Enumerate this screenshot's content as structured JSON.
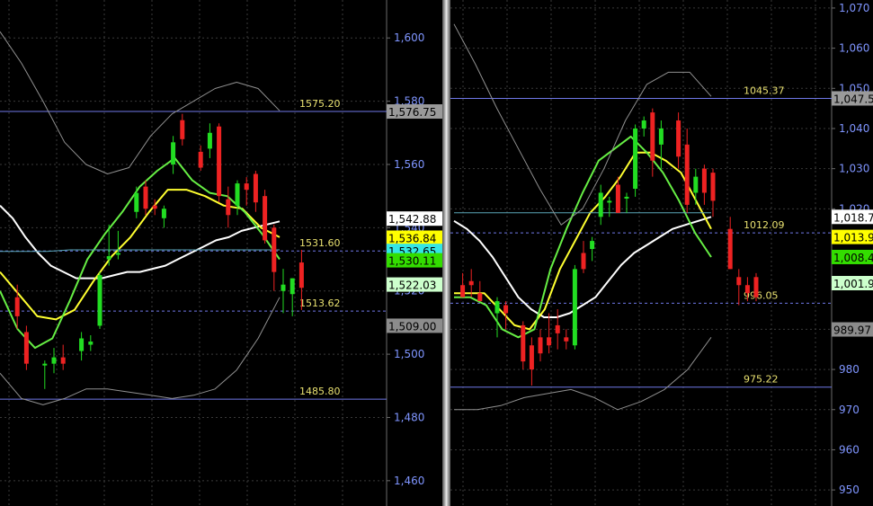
{
  "chart_data": [
    {
      "type": "candlestick",
      "y_axis_ticks": [
        "1,600",
        "1,580",
        "1,560",
        "1,540",
        "1,520",
        "1,500",
        "1,480",
        "1,460"
      ],
      "y_axis_tick_values": [
        1600,
        1580,
        1560,
        1540,
        1520,
        1500,
        1480,
        1460
      ],
      "ylim": [
        1452,
        1612
      ],
      "grid": true,
      "x_count": 40,
      "reference_lines": [
        {
          "label": "1575.20",
          "value": 1576.75,
          "color": "#6f78e8",
          "dashed": false
        },
        {
          "label": "1531.60",
          "value": 1532.65,
          "color": "#6f78e8",
          "dashed": true
        },
        {
          "label": "1513.62",
          "value": 1513.62,
          "color": "#6f78e8",
          "dashed": true
        },
        {
          "label": "1485.80",
          "value": 1485.8,
          "color": "#6f78e8",
          "dashed": false
        }
      ],
      "price_tags": [
        {
          "label": "1,576.75",
          "value": 1576.75,
          "bg": "#9a9a9a",
          "fg": "#000000"
        },
        {
          "label": "1,542.88",
          "value": 1542.88,
          "bg": "#ffffff",
          "fg": "#000000"
        },
        {
          "label": "1,536.84",
          "value": 1536.84,
          "bg": "#ffff00",
          "fg": "#000000"
        },
        {
          "label": "1,532.65",
          "value": 1532.65,
          "bg": "#33e6e6",
          "fg": "#000000"
        },
        {
          "label": "1,530.11",
          "value": 1529.7,
          "bg": "#33dd00",
          "fg": "#000000"
        },
        {
          "label": "1,522.03",
          "value": 1522.03,
          "bg": "#ccffcc",
          "fg": "#000000"
        },
        {
          "label": "1,509.00",
          "value": 1509.0,
          "bg": "#8c8c8c",
          "fg": "#000000"
        }
      ],
      "candles": [
        {
          "x": 1,
          "o": 1518,
          "h": 1522,
          "l": 1508,
          "c": 1512
        },
        {
          "x": 2,
          "o": 1507,
          "h": 1509,
          "l": 1495,
          "c": 1497
        },
        {
          "x": 4,
          "o": 1497,
          "h": 1498,
          "l": 1489,
          "c": 1497
        },
        {
          "x": 5,
          "o": 1497,
          "h": 1502,
          "l": 1494,
          "c": 1499
        },
        {
          "x": 6,
          "o": 1499,
          "h": 1503,
          "l": 1495,
          "c": 1497
        },
        {
          "x": 8,
          "o": 1501,
          "h": 1507,
          "l": 1498,
          "c": 1505
        },
        {
          "x": 9,
          "o": 1503,
          "h": 1506,
          "l": 1501,
          "c": 1504
        },
        {
          "x": 10,
          "o": 1509,
          "h": 1526,
          "l": 1508,
          "c": 1525
        },
        {
          "x": 11,
          "o": 1530,
          "h": 1541,
          "l": 1528,
          "c": 1531
        },
        {
          "x": 12,
          "o": 1532,
          "h": 1539,
          "l": 1530,
          "c": 1532
        },
        {
          "x": 14,
          "o": 1545,
          "h": 1553,
          "l": 1543,
          "c": 1551
        },
        {
          "x": 15,
          "o": 1553,
          "h": 1555,
          "l": 1544,
          "c": 1546
        },
        {
          "x": 16,
          "o": 1547,
          "h": 1549,
          "l": 1544,
          "c": 1546
        },
        {
          "x": 17,
          "o": 1543,
          "h": 1547,
          "l": 1540,
          "c": 1546
        },
        {
          "x": 18,
          "o": 1560,
          "h": 1569,
          "l": 1557,
          "c": 1567
        },
        {
          "x": 19,
          "o": 1574,
          "h": 1576,
          "l": 1566,
          "c": 1568
        },
        {
          "x": 21,
          "o": 1564,
          "h": 1566,
          "l": 1558,
          "c": 1559
        },
        {
          "x": 22,
          "o": 1565,
          "h": 1573,
          "l": 1562,
          "c": 1570
        },
        {
          "x": 23,
          "o": 1572,
          "h": 1573,
          "l": 1548,
          "c": 1550
        },
        {
          "x": 24,
          "o": 1549,
          "h": 1553,
          "l": 1540,
          "c": 1544
        },
        {
          "x": 25,
          "o": 1547,
          "h": 1555,
          "l": 1544,
          "c": 1554
        },
        {
          "x": 26,
          "o": 1554,
          "h": 1556,
          "l": 1547,
          "c": 1552
        },
        {
          "x": 27,
          "o": 1557,
          "h": 1558,
          "l": 1545,
          "c": 1548
        },
        {
          "x": 28,
          "o": 1550,
          "h": 1552,
          "l": 1535,
          "c": 1536
        },
        {
          "x": 29,
          "o": 1540,
          "h": 1541,
          "l": 1520,
          "c": 1526
        },
        {
          "x": 30,
          "o": 1520,
          "h": 1527,
          "l": 1513,
          "c": 1522
        },
        {
          "x": 31,
          "o": 1519,
          "h": 1524,
          "l": 1512,
          "c": 1524
        },
        {
          "x": 32,
          "o": 1529,
          "h": 1533,
          "l": 1514,
          "c": 1521
        }
      ],
      "lines": [
        {
          "name": "white",
          "color": "#ffffff",
          "width": 2,
          "values": [
            1547,
            1543,
            1537,
            1532,
            1528,
            1526,
            1524,
            1524,
            1524,
            1525,
            1526,
            1526,
            1527,
            1528,
            1530,
            1532,
            1534,
            1536,
            1537,
            1539,
            1540,
            1541,
            1542
          ]
        },
        {
          "name": "yellow",
          "color": "#ffff30",
          "width": 2,
          "values": [
            1526,
            1519,
            1512,
            1511,
            1514,
            1523,
            1531,
            1537,
            1545,
            1552,
            1552,
            1550,
            1547,
            1546,
            1540,
            1537
          ]
        },
        {
          "name": "green",
          "color": "#66ee44",
          "width": 2,
          "values": [
            1520,
            1508,
            1502,
            1505,
            1517,
            1530,
            1538,
            1545,
            1553,
            1558,
            1562,
            1555,
            1551,
            1550,
            1545,
            1538,
            1530
          ]
        },
        {
          "name": "cyan",
          "color": "#5aa6b8",
          "width": 1,
          "values": [
            1532.5,
            1532.5,
            1532.5,
            1533,
            1533,
            1533,
            1533,
            1533,
            1533,
            1533,
            1533,
            1533,
            1533
          ]
        },
        {
          "name": "upper-band",
          "color": "#909090",
          "width": 1,
          "values": [
            1602,
            1592,
            1580,
            1567,
            1560,
            1557,
            1559,
            1569,
            1576,
            1580,
            1584,
            1586,
            1584,
            1577
          ]
        },
        {
          "name": "lower-band",
          "color": "#909090",
          "width": 1,
          "values": [
            1494,
            1486,
            1484,
            1486,
            1489,
            1489,
            1488,
            1487,
            1486,
            1487,
            1489,
            1495,
            1505,
            1518
          ]
        }
      ]
    },
    {
      "type": "candlestick",
      "y_axis_ticks": [
        "1,070",
        "1,060",
        "1,050",
        "1,040",
        "1,030",
        "1,020",
        "990",
        "980",
        "970",
        "960",
        "950"
      ],
      "y_axis_tick_values": [
        1070,
        1060,
        1050,
        1040,
        1030,
        1020,
        990,
        980,
        970,
        960,
        950
      ],
      "ylim": [
        946,
        1072
      ],
      "grid": true,
      "x_count": 40,
      "reference_lines": [
        {
          "label": "1045.37",
          "value": 1047.5,
          "color": "#6f78e8",
          "dashed": false
        },
        {
          "label": "1012.09",
          "value": 1014.0,
          "color": "#6f78e8",
          "dashed": true
        },
        {
          "label": "996.05",
          "value": 996.5,
          "color": "#6f78e8",
          "dashed": true
        },
        {
          "label": "975.22",
          "value": 975.6,
          "color": "#6f78e8",
          "dashed": false
        }
      ],
      "price_tags": [
        {
          "label": "1,047.5",
          "value": 1047.5,
          "bg": "#9a9a9a",
          "fg": "#000000"
        },
        {
          "label": "1,018.7",
          "value": 1018.0,
          "bg": "#ffffff",
          "fg": "#000000"
        },
        {
          "label": "1,013.9",
          "value": 1013.0,
          "bg": "#ffff00",
          "fg": "#000000"
        },
        {
          "label": "1,008.4",
          "value": 1008.0,
          "bg": "#33dd00",
          "fg": "#000000"
        },
        {
          "label": "1,001.9",
          "value": 1001.5,
          "bg": "#ccffcc",
          "fg": "#000000"
        },
        {
          "label": "989.97",
          "value": 989.97,
          "bg": "#8c8c8c",
          "fg": "#000000"
        }
      ],
      "candles": [
        {
          "x": 1,
          "o": 1001,
          "h": 1004,
          "l": 998,
          "c": 998
        },
        {
          "x": 2,
          "o": 1002,
          "h": 1005,
          "l": 998,
          "c": 1001
        },
        {
          "x": 3,
          "o": 999,
          "h": 1002,
          "l": 997,
          "c": 997
        },
        {
          "x": 5,
          "o": 994,
          "h": 998,
          "l": 988,
          "c": 997
        },
        {
          "x": 6,
          "o": 996,
          "h": 997,
          "l": 990,
          "c": 994
        },
        {
          "x": 8,
          "o": 991,
          "h": 992,
          "l": 980,
          "c": 982
        },
        {
          "x": 9,
          "o": 986,
          "h": 988,
          "l": 976,
          "c": 980
        },
        {
          "x": 10,
          "o": 988,
          "h": 990,
          "l": 982,
          "c": 984
        },
        {
          "x": 11,
          "o": 988,
          "h": 994,
          "l": 984,
          "c": 986
        },
        {
          "x": 12,
          "o": 991,
          "h": 995,
          "l": 985,
          "c": 989
        },
        {
          "x": 13,
          "o": 988,
          "h": 990,
          "l": 985,
          "c": 987
        },
        {
          "x": 14,
          "o": 986,
          "h": 1006,
          "l": 985,
          "c": 1005
        },
        {
          "x": 15,
          "o": 1009,
          "h": 1012,
          "l": 1004,
          "c": 1005
        },
        {
          "x": 16,
          "o": 1010,
          "h": 1013,
          "l": 1007,
          "c": 1012
        },
        {
          "x": 17,
          "o": 1018,
          "h": 1026,
          "l": 1016,
          "c": 1024
        },
        {
          "x": 18,
          "o": 1022,
          "h": 1023,
          "l": 1018,
          "c": 1022
        },
        {
          "x": 19,
          "o": 1026,
          "h": 1028,
          "l": 1019,
          "c": 1019
        },
        {
          "x": 20,
          "o": 1023,
          "h": 1024,
          "l": 1019,
          "c": 1023
        },
        {
          "x": 21,
          "o": 1025,
          "h": 1041,
          "l": 1023,
          "c": 1040
        },
        {
          "x": 22,
          "o": 1040,
          "h": 1043,
          "l": 1038,
          "c": 1042
        },
        {
          "x": 23,
          "o": 1044,
          "h": 1045,
          "l": 1028,
          "c": 1032
        },
        {
          "x": 24,
          "o": 1036,
          "h": 1042,
          "l": 1030,
          "c": 1040
        },
        {
          "x": 26,
          "o": 1042,
          "h": 1044,
          "l": 1030,
          "c": 1033
        },
        {
          "x": 27,
          "o": 1036,
          "h": 1040,
          "l": 1019,
          "c": 1021
        },
        {
          "x": 28,
          "o": 1024,
          "h": 1030,
          "l": 1021,
          "c": 1028
        },
        {
          "x": 29,
          "o": 1030,
          "h": 1031,
          "l": 1021,
          "c": 1024
        },
        {
          "x": 30,
          "o": 1029,
          "h": 1030,
          "l": 1018,
          "c": 1022
        },
        {
          "x": 32,
          "o": 1015,
          "h": 1018,
          "l": 1005,
          "c": 1005
        },
        {
          "x": 33,
          "o": 1003,
          "h": 1005,
          "l": 996,
          "c": 1001
        },
        {
          "x": 34,
          "o": 1001,
          "h": 1003,
          "l": 997,
          "c": 999
        },
        {
          "x": 35,
          "o": 1003,
          "h": 1004,
          "l": 997,
          "c": 998
        }
      ],
      "lines": [
        {
          "name": "white",
          "color": "#ffffff",
          "width": 2,
          "values": [
            1017,
            1015,
            1012,
            1008,
            1003,
            998,
            995,
            993,
            993,
            994,
            996,
            998,
            1002,
            1006,
            1009,
            1011,
            1013,
            1015,
            1016,
            1017,
            1018
          ]
        },
        {
          "name": "yellow",
          "color": "#ffff30",
          "width": 2,
          "values": [
            999,
            999,
            999,
            995,
            991,
            990,
            995,
            1005,
            1012,
            1019,
            1023,
            1028,
            1034,
            1034,
            1032,
            1029,
            1022,
            1015
          ]
        },
        {
          "name": "green",
          "color": "#66ee44",
          "width": 2,
          "values": [
            998,
            998,
            996,
            990,
            988,
            990,
            1005,
            1015,
            1024,
            1032,
            1035,
            1038,
            1034,
            1029,
            1022,
            1014,
            1008
          ]
        },
        {
          "name": "cyan",
          "color": "#5aa6b8",
          "width": 1,
          "values": [
            1019,
            1019,
            1019,
            1019
          ]
        },
        {
          "name": "upper-band",
          "color": "#909090",
          "width": 1,
          "values": [
            1066,
            1056,
            1045,
            1035,
            1025,
            1016,
            1020,
            1030,
            1042,
            1051,
            1054,
            1054,
            1048
          ]
        },
        {
          "name": "lower-band",
          "color": "#909090",
          "width": 1,
          "values": [
            970,
            970,
            971,
            973,
            974,
            975,
            973,
            970,
            972,
            975,
            980,
            988
          ]
        }
      ]
    }
  ]
}
